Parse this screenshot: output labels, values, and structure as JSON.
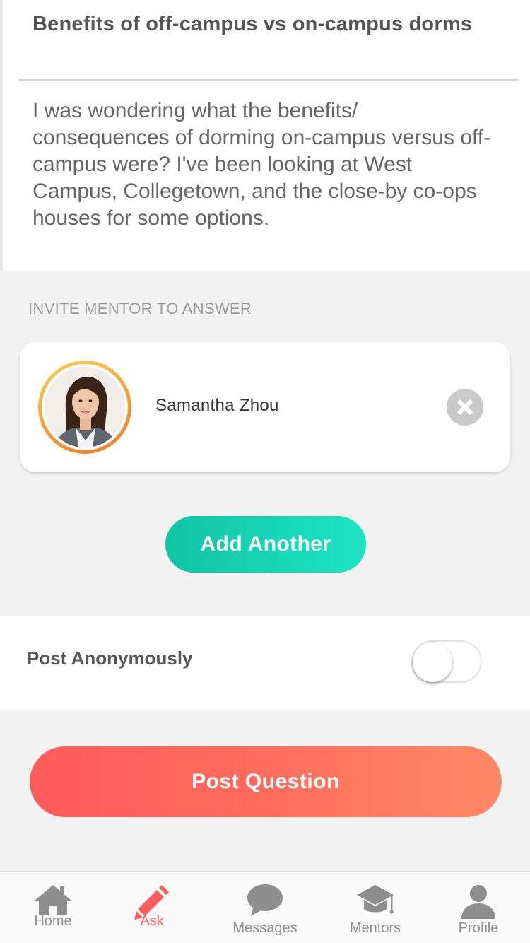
{
  "question": {
    "title": "Benefits of off-campus vs on-campus dorms",
    "body": "I was wondering what the benefits/ consequences of dorming on-campus versus off-campus were? I've been looking at West Campus, Collegetown, and the close-by co-ops houses for some options."
  },
  "invite": {
    "heading": "INVITE MENTOR TO ANSWER",
    "mentor": {
      "name": "Samantha Zhou"
    },
    "add_label": "Add Another"
  },
  "anonymous": {
    "label": "Post Anonymously",
    "enabled": false
  },
  "post": {
    "label": "Post Question"
  },
  "tabs": [
    {
      "label": "Home",
      "icon": "home-icon"
    },
    {
      "label": "Ask",
      "icon": "pencil-icon",
      "active": true
    },
    {
      "label": "Messages",
      "icon": "chat-bubble-icon"
    },
    {
      "label": "Mentors",
      "icon": "graduation-cap-icon"
    },
    {
      "label": "Profile",
      "icon": "person-icon"
    }
  ],
  "colors": {
    "accent_teal": "#1fd3b6",
    "accent_red": "#ff5c5c",
    "tab_inactive": "#8e8e8e"
  }
}
